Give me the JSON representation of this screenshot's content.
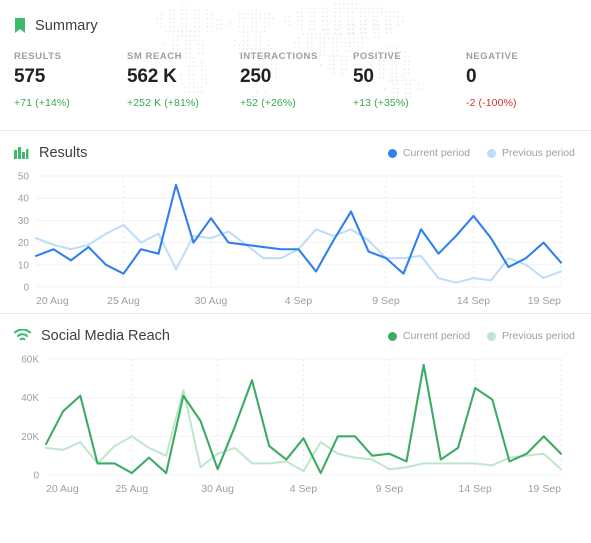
{
  "summary": {
    "icon": "bookmark-icon",
    "title": "Summary",
    "accent_color": "#3dba6f",
    "kpis": [
      {
        "label": "RESULTS",
        "value": "575",
        "delta": "+71 (+14%)",
        "direction": "up"
      },
      {
        "label": "SM REACH",
        "value": "562 K",
        "delta": "+252 K (+81%)",
        "direction": "up"
      },
      {
        "label": "INTERACTIONS",
        "value": "250",
        "delta": "+52 (+26%)",
        "direction": "up"
      },
      {
        "label": "POSITIVE",
        "value": "50",
        "delta": "+13 (+35%)",
        "direction": "up"
      },
      {
        "label": "NEGATIVE",
        "value": "0",
        "delta": "-2 (-100%)",
        "direction": "down"
      }
    ]
  },
  "results_card": {
    "icon": "bar-chart-icon",
    "title": "Results",
    "legend": [
      {
        "label": "Current period",
        "color": "#2f80ed"
      },
      {
        "label": "Previous period",
        "color": "#bcdcfb"
      }
    ]
  },
  "reach_card": {
    "icon": "wifi-icon",
    "title": "Social Media Reach",
    "legend": [
      {
        "label": "Current period",
        "color": "#3cab63"
      },
      {
        "label": "Previous period",
        "color": "#bfe6cd"
      }
    ]
  },
  "chart_data": [
    {
      "id": "results",
      "type": "line",
      "title": "Results",
      "xlabel": "",
      "ylabel": "",
      "grid": true,
      "legend_position": "top-right",
      "ylim": [
        0,
        50
      ],
      "yticks": [
        0,
        10,
        20,
        30,
        40,
        50
      ],
      "ytick_labels": [
        "0",
        "10",
        "20",
        "30",
        "40",
        "50"
      ],
      "x": [
        "20 Aug",
        "21 Aug",
        "22 Aug",
        "23 Aug",
        "24 Aug",
        "25 Aug",
        "26 Aug",
        "27 Aug",
        "28 Aug",
        "29 Aug",
        "30 Aug",
        "31 Aug",
        "1 Sep",
        "2 Sep",
        "3 Sep",
        "4 Sep",
        "5 Sep",
        "6 Sep",
        "7 Sep",
        "8 Sep",
        "9 Sep",
        "10 Sep",
        "11 Sep",
        "12 Sep",
        "13 Sep",
        "14 Sep",
        "15 Sep",
        "16 Sep",
        "17 Sep",
        "18 Sep",
        "19 Sep"
      ],
      "xtick_labels": [
        "20 Aug",
        "25 Aug",
        "30 Aug",
        "4 Sep",
        "9 Sep",
        "14 Sep",
        "19 Sep"
      ],
      "xtick_indices": [
        0,
        5,
        10,
        15,
        20,
        25,
        30
      ],
      "series": [
        {
          "name": "Current period",
          "color": "#2f80ed",
          "values": [
            14,
            17,
            12,
            18,
            10,
            6,
            17,
            15,
            46,
            20,
            31,
            20,
            19,
            18,
            17,
            17,
            7,
            21,
            34,
            16,
            13,
            6,
            26,
            15,
            23,
            32,
            22,
            9,
            13,
            20,
            11
          ]
        },
        {
          "name": "Previous period",
          "color": "#bcdcfb",
          "values": [
            22,
            19,
            17,
            19,
            24,
            28,
            20,
            24,
            8,
            23,
            22,
            25,
            19,
            13,
            13,
            17,
            26,
            23,
            26,
            21,
            13,
            13,
            14,
            4,
            2,
            4,
            3,
            13,
            10,
            4,
            7
          ]
        }
      ]
    },
    {
      "id": "social_media_reach",
      "type": "line",
      "title": "Social Media Reach",
      "xlabel": "",
      "ylabel": "",
      "grid": true,
      "legend_position": "top-right",
      "ylim": [
        0,
        60000
      ],
      "yticks": [
        0,
        20000,
        40000,
        60000
      ],
      "ytick_labels": [
        "0",
        "20K",
        "40K",
        "60K"
      ],
      "x": [
        "20 Aug",
        "21 Aug",
        "22 Aug",
        "23 Aug",
        "24 Aug",
        "25 Aug",
        "26 Aug",
        "27 Aug",
        "28 Aug",
        "29 Aug",
        "30 Aug",
        "31 Aug",
        "1 Sep",
        "2 Sep",
        "3 Sep",
        "4 Sep",
        "5 Sep",
        "6 Sep",
        "7 Sep",
        "8 Sep",
        "9 Sep",
        "10 Sep",
        "11 Sep",
        "12 Sep",
        "13 Sep",
        "14 Sep",
        "15 Sep",
        "16 Sep",
        "17 Sep",
        "18 Sep",
        "19 Sep"
      ],
      "xtick_labels": [
        "20 Aug",
        "25 Aug",
        "30 Aug",
        "4 Sep",
        "9 Sep",
        "14 Sep",
        "19 Sep"
      ],
      "xtick_indices": [
        0,
        5,
        10,
        15,
        20,
        25,
        30
      ],
      "series": [
        {
          "name": "Current period",
          "color": "#3cab63",
          "values": [
            16000,
            33000,
            41000,
            6000,
            6000,
            1000,
            9000,
            1000,
            41000,
            28000,
            3000,
            25000,
            49000,
            15000,
            8000,
            19000,
            1000,
            20000,
            20000,
            10000,
            11000,
            7000,
            57000,
            8000,
            14000,
            45000,
            39000,
            7000,
            11000,
            20000,
            11000
          ]
        },
        {
          "name": "Previous period",
          "color": "#bfe6cd",
          "values": [
            14000,
            13000,
            17000,
            6000,
            15000,
            20000,
            14000,
            10000,
            44000,
            4000,
            11000,
            14000,
            6000,
            6000,
            7000,
            2000,
            17000,
            11000,
            9000,
            8000,
            3000,
            4000,
            6000,
            6000,
            6000,
            6000,
            5000,
            9000,
            10000,
            11000,
            3000
          ]
        }
      ]
    }
  ]
}
